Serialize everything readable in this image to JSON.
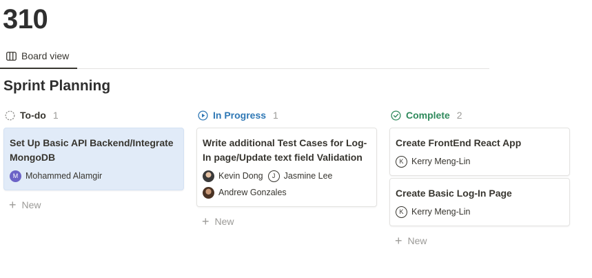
{
  "page": {
    "title": "310"
  },
  "view_tabs": [
    {
      "label": "Board view",
      "icon": "board-view-icon"
    }
  ],
  "database": {
    "title": "Sprint Planning"
  },
  "colors": {
    "todo": "#6b6b6b",
    "in_progress": "#2f78b5",
    "complete": "#2f8a5c",
    "highlight_card": "#e1ebf8"
  },
  "columns": [
    {
      "name": "To-do",
      "count": "1",
      "icon": "dashed-circle-icon",
      "cards": [
        {
          "title": "Set Up Basic API Backend/Integrate MongoDB",
          "people": [
            {
              "name": "Mohammed Alamgir",
              "initial": "M"
            }
          ]
        }
      ],
      "new_label": "New"
    },
    {
      "name": "In Progress",
      "count": "1",
      "icon": "play-circle-icon",
      "cards": [
        {
          "title": "Write additional Test Cases for Log-In page/Update text field Validation",
          "people": [
            {
              "name": "Kevin Dong"
            },
            {
              "name": "Jasmine Lee",
              "initial": "J"
            },
            {
              "name": "Andrew Gonzales"
            }
          ]
        }
      ],
      "new_label": "New"
    },
    {
      "name": "Complete",
      "count": "2",
      "icon": "check-circle-icon",
      "cards": [
        {
          "title": "Create FrontEnd React App",
          "people": [
            {
              "name": "Kerry Meng-Lin",
              "initial": "K"
            }
          ]
        },
        {
          "title": "Create Basic Log-In Page",
          "people": [
            {
              "name": "Kerry Meng-Lin",
              "initial": "K"
            }
          ]
        }
      ],
      "new_label": "New"
    }
  ]
}
